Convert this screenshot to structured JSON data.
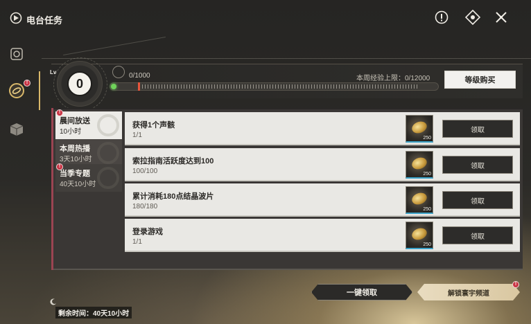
{
  "app": {
    "title": "电台任务"
  },
  "top_icons": [
    {
      "name": "info-icon"
    },
    {
      "name": "target-icon"
    },
    {
      "name": "close-icon"
    }
  ],
  "level": {
    "badge": "Lv",
    "value": "0",
    "xp_text": "0/1000",
    "xp_fraction": 0.0,
    "weekly_cap": "本周经验上限：0/12000",
    "buy_button": "等级购买"
  },
  "categories": [
    {
      "name": "晨间放送",
      "time": "10小时",
      "alert": true,
      "selected": true
    },
    {
      "name": "本周热播",
      "time": "3天10小时",
      "alert": false,
      "selected": false
    },
    {
      "name": "当季专题",
      "time": "40天10小时",
      "alert": true,
      "selected": false
    }
  ],
  "tasks": [
    {
      "title": "获得1个声骸",
      "progress": "1/1",
      "reward_qty": "250",
      "claim": "领取"
    },
    {
      "title": "索拉指南活跃度达到100",
      "progress": "100/100",
      "reward_qty": "250",
      "claim": "领取"
    },
    {
      "title": "累计消耗180点结晶波片",
      "progress": "180/180",
      "reward_qty": "250",
      "claim": "领取"
    },
    {
      "title": "登录游戏",
      "progress": "1/1",
      "reward_qty": "250",
      "claim": "领取"
    }
  ],
  "footer": {
    "claim_all": "一键领取",
    "unlock": "解锁寰宇频道",
    "remaining": "剩余时间：40天10小时"
  },
  "colors": {
    "accent": "#d9b86a",
    "alert": "#c93444",
    "xp_dot": "#6fd35a",
    "xp_marker": "#e6553c"
  }
}
